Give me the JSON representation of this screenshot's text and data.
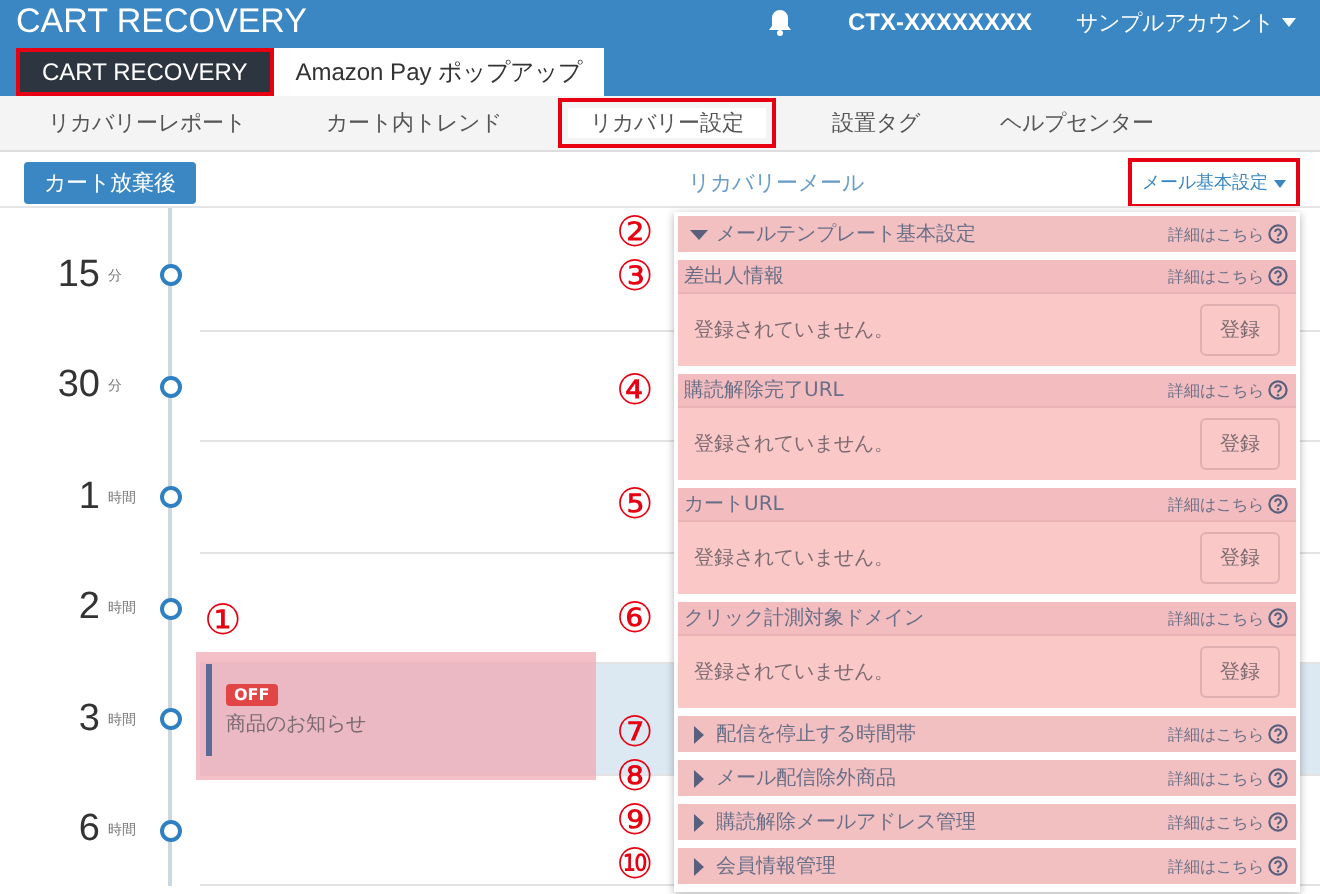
{
  "app_title": "CART RECOVERY",
  "header": {
    "account_id": "CTX-XXXXXXXX",
    "account_menu": "サンプルアカウント"
  },
  "product_tabs": [
    {
      "label": "CART RECOVERY",
      "selected": true,
      "highlighted": true
    },
    {
      "label": "Amazon Pay ポップアップ",
      "selected": false,
      "highlighted": false
    }
  ],
  "nav": [
    {
      "label": "リカバリーレポート",
      "selected": false,
      "highlighted": false
    },
    {
      "label": "カート内トレンド",
      "selected": false,
      "highlighted": false
    },
    {
      "label": "リカバリー設定",
      "selected": true,
      "highlighted": true
    },
    {
      "label": "設置タグ",
      "selected": false,
      "highlighted": false
    },
    {
      "label": "ヘルプセンター",
      "selected": false,
      "highlighted": false
    }
  ],
  "timing_button": "カート放棄後",
  "panel_title": "リカバリーメール",
  "settings_menu": {
    "label": "メール基本設定",
    "highlighted": true
  },
  "timeline": [
    {
      "value": "15",
      "unit": "分"
    },
    {
      "value": "30",
      "unit": "分"
    },
    {
      "value": "1",
      "unit": "時間"
    },
    {
      "value": "2",
      "unit": "時間"
    },
    {
      "value": "3",
      "unit": "時間",
      "email": {
        "status": "OFF",
        "title": "商品のお知らせ",
        "annotation": "①"
      }
    },
    {
      "value": "6",
      "unit": "時間"
    }
  ],
  "sections": [
    {
      "kind": "group",
      "title": "メールテンプレート基本設定",
      "expanded": true,
      "help": "詳細はこちら",
      "annotation": "②"
    },
    {
      "kind": "field",
      "title": "差出人情報",
      "help": "詳細はこちら",
      "value": "登録されていません。",
      "button": "登録",
      "annotation": "③"
    },
    {
      "kind": "field",
      "title": "購読解除完了URL",
      "help": "詳細はこちら",
      "value": "登録されていません。",
      "button": "登録",
      "annotation": "④"
    },
    {
      "kind": "field",
      "title": "カートURL",
      "help": "詳細はこちら",
      "value": "登録されていません。",
      "button": "登録",
      "annotation": "⑤"
    },
    {
      "kind": "field",
      "title": "クリック計測対象ドメイン",
      "help": "詳細はこちら",
      "value": "登録されていません。",
      "button": "登録",
      "annotation": "⑥"
    },
    {
      "kind": "group",
      "title": "配信を停止する時間帯",
      "expanded": false,
      "help": "詳細はこちら",
      "annotation": "⑦"
    },
    {
      "kind": "group",
      "title": "メール配信除外商品",
      "expanded": false,
      "help": "詳細はこちら",
      "annotation": "⑧"
    },
    {
      "kind": "group",
      "title": "購読解除メールアドレス管理",
      "expanded": false,
      "help": "詳細はこちら",
      "annotation": "⑨"
    },
    {
      "kind": "group",
      "title": "会員情報管理",
      "expanded": false,
      "help": "詳細はこちら",
      "annotation": "⑩"
    }
  ]
}
